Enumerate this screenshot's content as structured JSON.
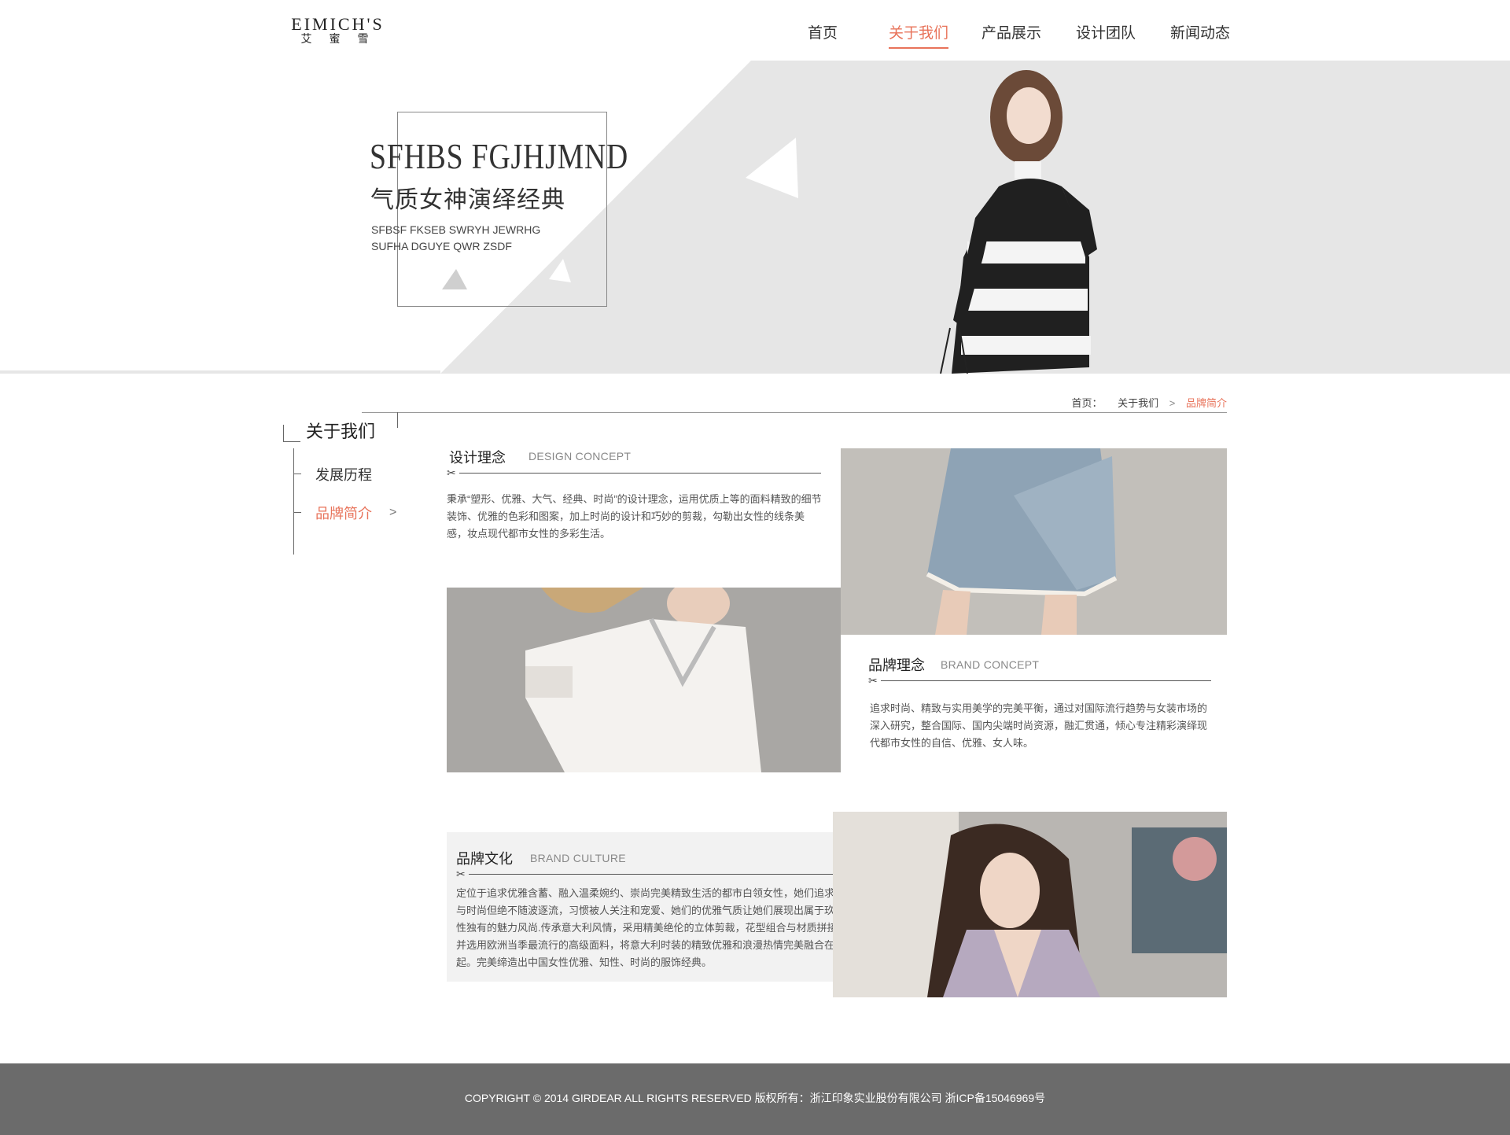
{
  "header": {
    "logo_en": "EIMICH'S",
    "logo_cn": "艾蜜雪",
    "nav": [
      {
        "label": "首页"
      },
      {
        "label": "关于我们"
      },
      {
        "label": "产品展示"
      },
      {
        "label": "设计团队"
      },
      {
        "label": "新闻动态"
      }
    ],
    "active_index": 1
  },
  "banner": {
    "title": "SFHBS FGJHJMND",
    "subtitle_cn": "气质女神演绎经典",
    "line1": "SFBSF FKSEB SWRYH JEWRHG",
    "line2": "SUFHA DGUYE QWR  ZSDF"
  },
  "breadcrumb": {
    "home": "首页：",
    "parent": "关于我们",
    "separator": ">",
    "current": "品牌简介"
  },
  "sidebar": {
    "title": "关于我们",
    "items": [
      {
        "label": "发展历程"
      },
      {
        "label": "品牌简介"
      }
    ],
    "active_arrow": ">"
  },
  "sections": {
    "design": {
      "title": "设计理念",
      "title_en": "DESIGN CONCEPT",
      "text": "秉承“塑形、优雅、大气、经典、时尚”的设计理念，运用优质上等的面料精致的细节装饰、优雅的色彩和图案，加上时尚的设计和巧妙的剪裁，勾勒出女性的线条美感，妆点现代都市女性的多彩生活。"
    },
    "brand": {
      "title": "品牌理念",
      "title_en": "BRAND CONCEPT",
      "text": "追求时尚、精致与实用美学的完美平衡，通过对国际流行趋势与女装市场的深入研究，整合国际、国内尖端时尚资源，融汇贯通，倾心专注精彩演绎现代都市女性的自信、优雅、女人味。"
    },
    "culture": {
      "title": "品牌文化",
      "title_en": "BRAND CULTURE",
      "text": "定位于追求优雅含蓄、融入温柔婉约、崇尚完美精致生活的都市白领女性，她们追求品质与时尚但绝不随波逐流，习惯被人关注和宠爱、她们的优雅气质让她们展现出属于玖姿女性独有的魅力风尚.传承意大利风情，采用精美绝伦的立体剪裁，花型组合与材质拼接，并选用欧洲当季最流行的高级面料，将意大利时装的精致优雅和浪漫热情完美融合在一起。完美缔造出中国女性优雅、知性、时尚的服饰经典。"
    },
    "scissor": "✂"
  },
  "footer": {
    "text": "COPYRIGHT © 2014 GIRDEAR ALL RIGHTS RESERVED 版权所有：浙江印象实业股份有限公司  浙ICP备15046969号"
  },
  "colors": {
    "accent": "#e8735a",
    "footer_bg": "#6b6b6b",
    "banner_gray": "#e6e6e6"
  }
}
